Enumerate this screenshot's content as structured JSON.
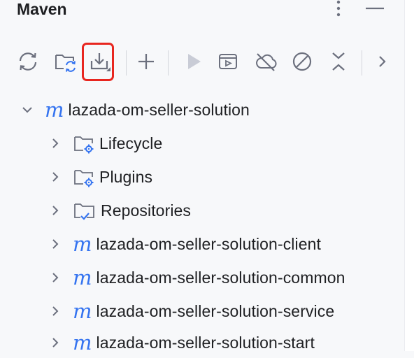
{
  "panel": {
    "title": "Maven"
  },
  "toolbar": {
    "items": [
      {
        "icon": "reload-icon",
        "name": "reload-all-projects-button"
      },
      {
        "icon": "folder-sync-icon",
        "name": "generate-sources-button"
      },
      {
        "icon": "download-icon",
        "name": "download-sources-button",
        "highlighted": true
      },
      {
        "icon": "plus-icon",
        "name": "add-maven-project-button"
      },
      {
        "icon": "run-icon",
        "name": "run-maven-build-button"
      },
      {
        "icon": "execute-goal-icon",
        "name": "execute-maven-goal-button"
      },
      {
        "icon": "offline-mode-icon",
        "name": "toggle-offline-mode-button"
      },
      {
        "icon": "skip-tests-icon",
        "name": "skip-tests-button"
      },
      {
        "icon": "collapse-all-icon",
        "name": "collapse-all-button"
      },
      {
        "icon": "chevron-right-icon",
        "name": "more-actions-button"
      }
    ],
    "highlight_color": "#e8261f"
  },
  "tree": {
    "root": {
      "label": "lazada-om-seller-solution",
      "icon_glyph": "m",
      "expanded": true
    },
    "children": [
      {
        "label": "Lifecycle",
        "icon": "folder-gear-icon"
      },
      {
        "label": "Plugins",
        "icon": "folder-gear-icon"
      },
      {
        "label": "Repositories",
        "icon": "folder-check-icon"
      },
      {
        "label": "lazada-om-seller-solution-client",
        "icon_glyph": "m"
      },
      {
        "label": "lazada-om-seller-solution-common",
        "icon_glyph": "m"
      },
      {
        "label": "lazada-om-seller-solution-service",
        "icon_glyph": "m"
      },
      {
        "label": "lazada-om-seller-solution-start",
        "icon_glyph": "m"
      }
    ]
  },
  "colors": {
    "accent": "#3574f0",
    "icon_gray": "#6c707e",
    "background": "#f7f8fa"
  }
}
